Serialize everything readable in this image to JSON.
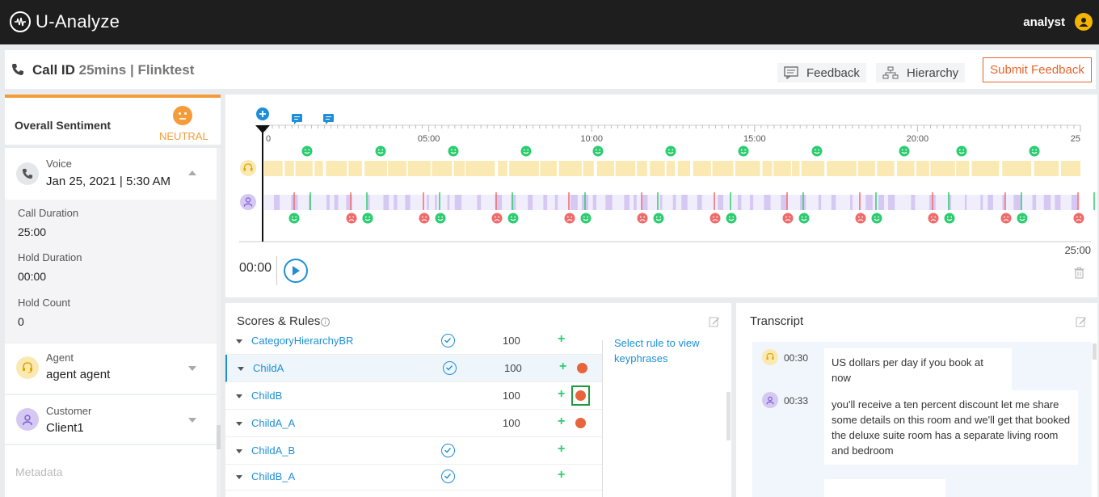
{
  "app": {
    "title": "U-Analyze",
    "user": "analyst"
  },
  "header": {
    "call_id_label": "Call ID",
    "duration": "25mins",
    "separator": "|",
    "project": "Flinktest",
    "feedback_label": "Feedback",
    "hierarchy_label": "Hierarchy",
    "submit_label": "Submit Feedback"
  },
  "sentiment": {
    "label": "Overall Sentiment",
    "value": "NEUTRAL",
    "color": "#f39c39"
  },
  "voice": {
    "label": "Voice",
    "date": "Jan 25, 2021 | 5:30 AM"
  },
  "call_details": [
    {
      "label": "Call Duration",
      "value": "25:00"
    },
    {
      "label": "Hold Duration",
      "value": "00:00"
    },
    {
      "label": "Hold Count",
      "value": "0"
    }
  ],
  "agent": {
    "label": "Agent",
    "name": "agent agent"
  },
  "customer": {
    "label": "Customer",
    "name": "Client1"
  },
  "metadata_label": "Metadata",
  "timeline": {
    "ticks": [
      "0",
      "05:00",
      "10:00",
      "15:00",
      "20:00",
      "25"
    ],
    "current_time": "00:00",
    "end_time": "25:00",
    "agent_color": "#fbe9b3",
    "customer_color": "#d5c8f3",
    "positive_color": "#2ecc71",
    "negative_color": "#f06a6a"
  },
  "scores": {
    "title": "Scores & Rules",
    "keyphrase_hint": "Select rule to view keyphrases",
    "rows": [
      {
        "name": "CategoryHierarchyBR",
        "score": "100",
        "check": true,
        "badge": false
      },
      {
        "name": "ChildA",
        "score": "100",
        "check": true,
        "badge": true
      },
      {
        "name": "ChildB",
        "score": "100",
        "check": false,
        "badge": true
      },
      {
        "name": "ChildA_A",
        "score": "100",
        "check": false,
        "badge": true
      },
      {
        "name": "ChildA_B",
        "score": "",
        "check": true,
        "badge": false
      },
      {
        "name": "ChildB_A",
        "score": "",
        "check": true,
        "badge": false
      }
    ],
    "plus": "+"
  },
  "transcript": {
    "title": "Transcript",
    "messages": [
      {
        "time": "00:30",
        "speaker": "agent",
        "text": "US dollars per day if you book at now"
      },
      {
        "time": "00:33",
        "speaker": "customer",
        "text": "you'll receive a ten percent discount let me share some details on this room and we'll get that booked the deluxe suite room has a separate living room and bedroom"
      }
    ]
  }
}
